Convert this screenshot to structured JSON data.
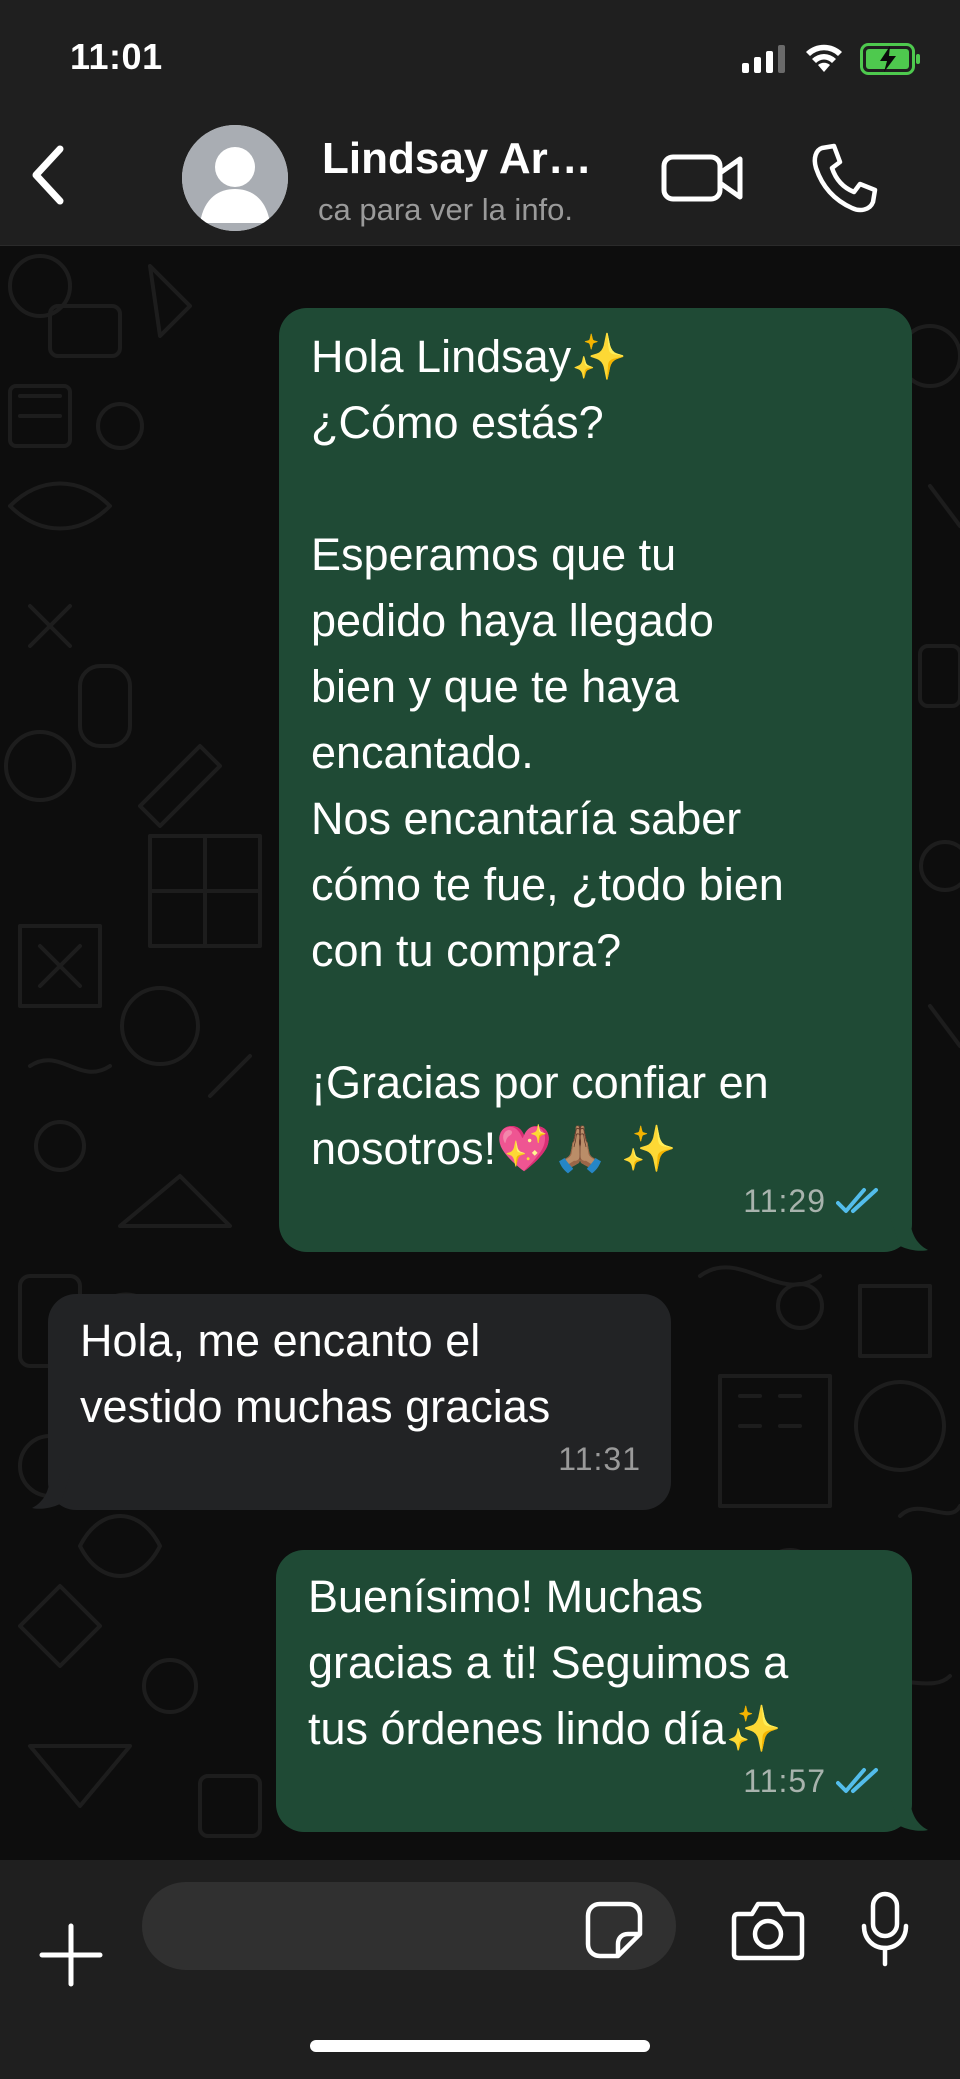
{
  "status_bar": {
    "time": "11:01",
    "signal_icon": "cellular-signal-icon",
    "wifi_icon": "wifi-icon",
    "battery_icon": "battery-charging-icon"
  },
  "header": {
    "contact_name": "Lindsay Ar…",
    "subtitle": "ca para ver la info.",
    "back_icon": "chevron-left-icon",
    "video_icon": "video-camera-icon",
    "call_icon": "phone-icon"
  },
  "messages": [
    {
      "direction": "outgoing",
      "text": "Hola Lindsay✨\n¿Cómo estás?\n\nEsperamos que tu\npedido haya llegado\nbien y que te haya\nencantado.\nNos encantaría saber\ncómo te fue, ¿todo bien\ncon tu compra?\n\n¡Gracias por confiar en\nnosotros!💖🙏🏽 ✨",
      "time": "11:29",
      "status": "read"
    },
    {
      "direction": "incoming",
      "text": "Hola, me encanto el\nvestido muchas gracias",
      "time": "11:31"
    },
    {
      "direction": "outgoing",
      "text": "Buenísimo! Muchas\ngracias a ti! Seguimos a\ntus órdenes lindo día✨",
      "time": "11:57",
      "status": "read"
    }
  ],
  "input_bar": {
    "placeholder": "",
    "value": "",
    "plus_icon": "plus-icon",
    "sticker_icon": "sticker-icon",
    "camera_icon": "camera-icon",
    "mic_icon": "microphone-icon"
  },
  "colors": {
    "outgoing_bubble": "#1f4a35",
    "incoming_bubble": "#222325",
    "read_ticks": "#53bdeb",
    "header_bg": "#1f1f1f"
  }
}
